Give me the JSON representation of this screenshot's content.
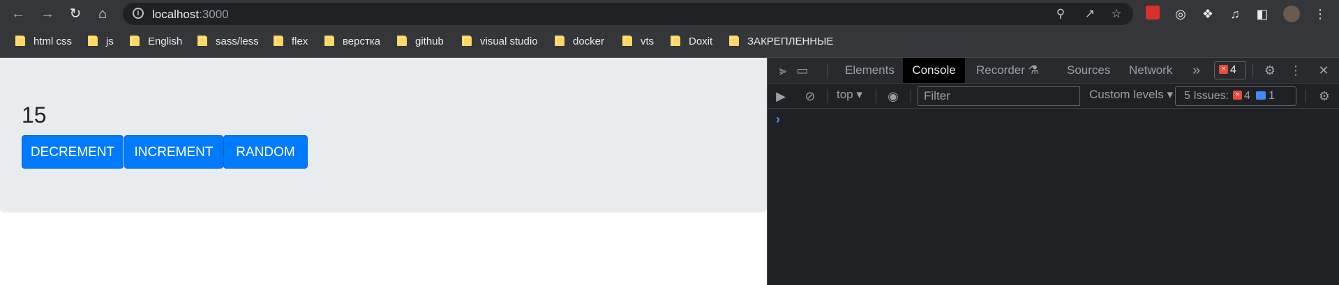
{
  "browser": {
    "url_host": "localhost",
    "url_port": ":3000",
    "nav": {
      "back_icon": "arrow-left-icon",
      "forward_icon": "arrow-right-icon",
      "reload_icon": "reload-icon",
      "home_icon": "home-icon"
    }
  },
  "bookmarks": [
    {
      "label": "html css"
    },
    {
      "label": "js"
    },
    {
      "label": "English"
    },
    {
      "label": "sass/less"
    },
    {
      "label": "flex"
    },
    {
      "label": "верстка"
    },
    {
      "label": "github"
    },
    {
      "label": "visual studio"
    },
    {
      "label": "docker"
    },
    {
      "label": "vts"
    },
    {
      "label": "Doxit"
    },
    {
      "label": "ЗАКРЕПЛЕННЫЕ"
    }
  ],
  "app": {
    "counter": "15",
    "buttons": {
      "decrement": "DECREMENT",
      "increment": "INCREMENT",
      "random": "RANDOM"
    },
    "button_color": "#007bff"
  },
  "devtools": {
    "tabs": {
      "elements": "Elements",
      "console": "Console",
      "recorder": "Recorder",
      "sources": "Sources",
      "network": "Network"
    },
    "more_tabs": "»",
    "error_count": "4",
    "context": "top",
    "filter_placeholder": "Filter",
    "levels": "Custom levels",
    "issues_label": "5 Issues:",
    "issues_errors": "4",
    "issues_info": "1",
    "prompt": "›"
  }
}
